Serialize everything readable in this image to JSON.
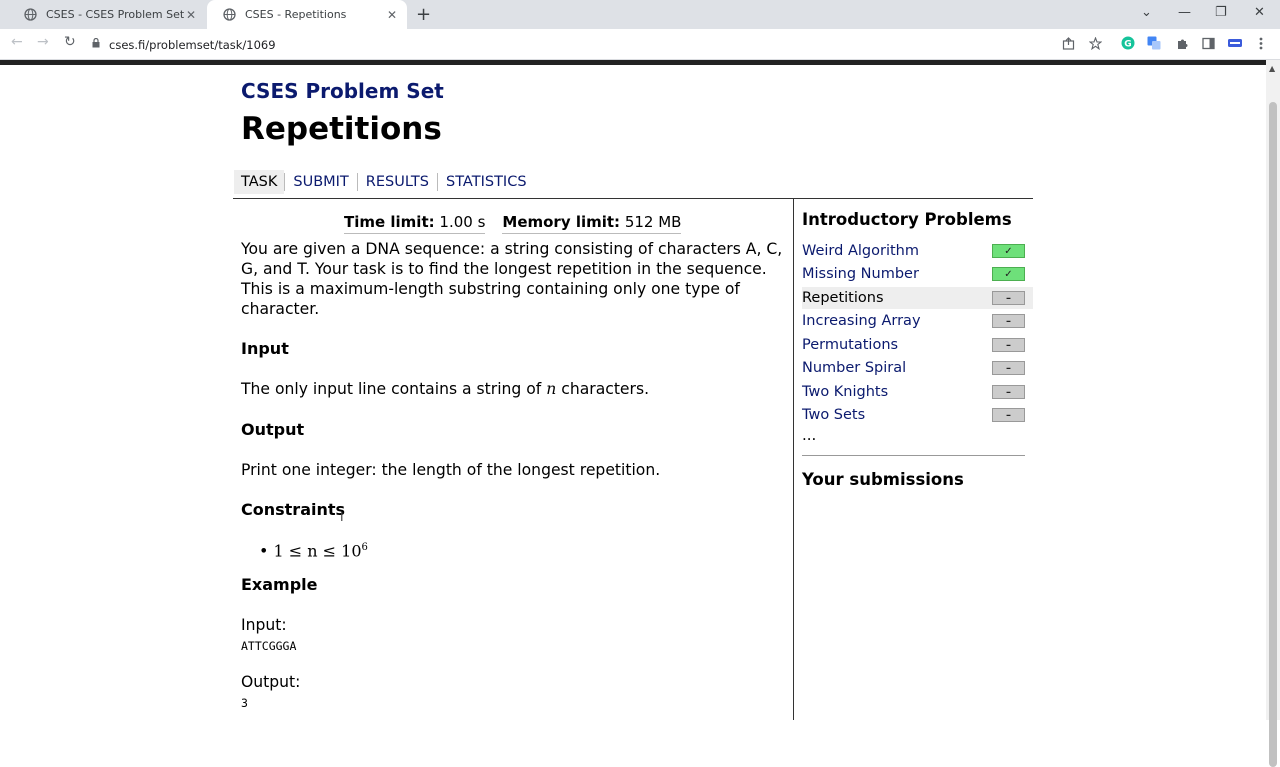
{
  "browser": {
    "tabs": [
      {
        "title": "CSES - CSES Problem Set - Tasks",
        "close": "✕"
      },
      {
        "title": "CSES - Repetitions",
        "close": "✕"
      }
    ],
    "new_tab": "+",
    "window_controls": {
      "minimize": "—",
      "restore": "❐",
      "close": "✕",
      "tab_search": "⌄"
    },
    "nav": {
      "back": "←",
      "forward": "→",
      "reload": "↻"
    },
    "url": "cses.fi/problemset/task/1069"
  },
  "site": {
    "title": "CSES Problem Set"
  },
  "page": {
    "title": "Repetitions",
    "tabs": [
      "TASK",
      "SUBMIT",
      "RESULTS",
      "STATISTICS"
    ],
    "limits": {
      "time_label": "Time limit:",
      "time_value": "1.00 s",
      "memory_label": "Memory limit:",
      "memory_value": "512 MB"
    },
    "statement": "You are given a DNA sequence: a string consisting of characters A, C, G, and T. Your task is to find the longest repetition in the sequence. This is a maximum-length substring containing only one type of character.",
    "input_heading": "Input",
    "input_text_pre": "The only input line contains a string of ",
    "input_var": "n",
    "input_text_post": " characters.",
    "output_heading": "Output",
    "output_text": "Print one integer: the length of the longest repetition.",
    "constraints_heading": "Constraints",
    "constraint_main": "1 ≤ n ≤ 10",
    "constraint_exp": "6",
    "example_heading": "Example",
    "example_input_label": "Input:",
    "example_input_value": "ATTCGGGA",
    "example_output_label": "Output:",
    "example_output_value": "3"
  },
  "sidebar": {
    "title": "Introductory Problems",
    "tasks": [
      {
        "name": "Weird Algorithm",
        "status": "✓",
        "solved": true
      },
      {
        "name": "Missing Number",
        "status": "✓",
        "solved": true
      },
      {
        "name": "Repetitions",
        "status": "–",
        "solved": false
      },
      {
        "name": "Increasing Array",
        "status": "–",
        "solved": false
      },
      {
        "name": "Permutations",
        "status": "–",
        "solved": false
      },
      {
        "name": "Number Spiral",
        "status": "–",
        "solved": false
      },
      {
        "name": "Two Knights",
        "status": "–",
        "solved": false
      },
      {
        "name": "Two Sets",
        "status": "–",
        "solved": false
      }
    ],
    "more": "...",
    "submissions_title": "Your submissions"
  },
  "colors": {
    "link": "#0b1a6e",
    "solved": "#6ee07a",
    "unsolved": "#cccccc"
  }
}
